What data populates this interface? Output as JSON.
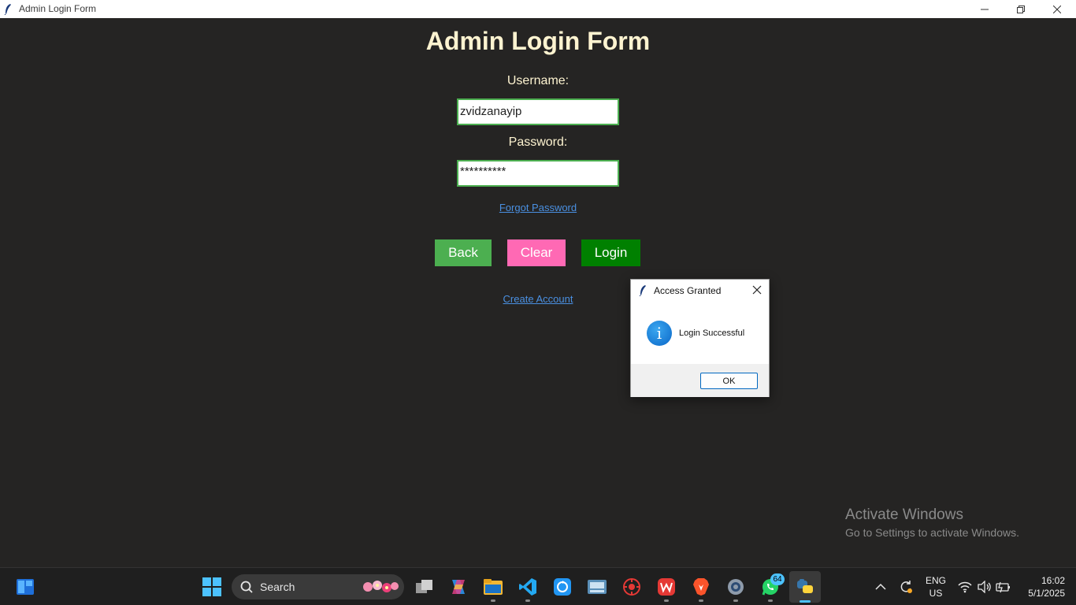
{
  "window": {
    "title": "Admin Login Form"
  },
  "form": {
    "heading": "Admin Login Form",
    "username_label": "Username:",
    "username_value": "zvidzanayip",
    "password_label": "Password:",
    "password_value": "**********",
    "forgot_link": "Forgot Password",
    "back_label": "Back",
    "clear_label": "Clear",
    "login_label": "Login",
    "create_link": "Create Account"
  },
  "dialog": {
    "title": "Access Granted",
    "message": "Login Successful",
    "ok_label": "OK"
  },
  "watermark": {
    "line1": "Activate Windows",
    "line2": "Go to Settings to activate Windows."
  },
  "taskbar": {
    "search_placeholder": "Search",
    "whatsapp_badge": "64",
    "lang_top": "ENG",
    "lang_bottom": "US",
    "time": "16:02",
    "date": "5/1/2025"
  },
  "colors": {
    "background": "#252423",
    "heading": "#fdf3d0",
    "field_border": "#4caf50",
    "back_button": "#4caf50",
    "clear_button": "#ff69b4",
    "login_button": "#008000",
    "link": "#4a90e2"
  },
  "icons": [
    "feather-icon",
    "minimize-icon",
    "maximize-icon",
    "close-icon",
    "info-icon",
    "windows-start-icon",
    "search-icon",
    "task-view-icon",
    "copilot-icon",
    "file-explorer-icon",
    "vscode-icon",
    "sync-app-icon",
    "keyboard-app-icon",
    "antivirus-icon",
    "wps-icon",
    "brave-icon",
    "settings-icon",
    "whatsapp-icon",
    "python-icon",
    "chevron-up-icon",
    "refresh-icon",
    "wifi-icon",
    "volume-icon",
    "battery-icon",
    "widgets-icon"
  ]
}
